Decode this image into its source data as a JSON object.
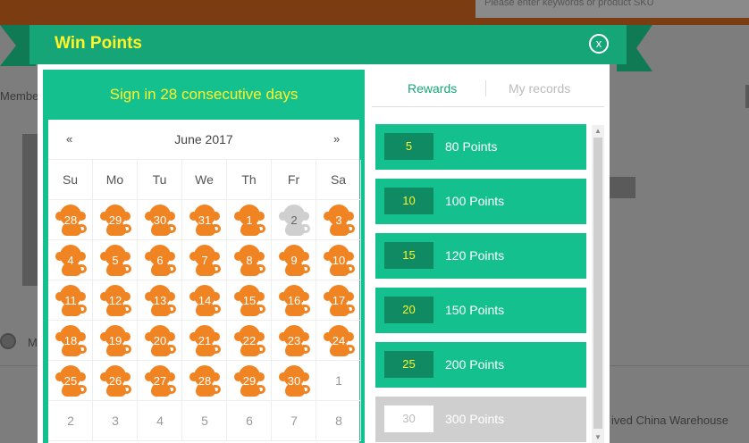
{
  "background": {
    "search_placeholder": "Please enter keywords or product SKU",
    "member_text": "Membe",
    "m_text": "M",
    "warehouse_text": "ived China Warehouse"
  },
  "modal": {
    "title": "Win Points",
    "close_icon": "x",
    "colors": {
      "accent": "#14c08e",
      "header": "#16a577",
      "title": "#fff42a",
      "signed": "#f08423",
      "missed": "#cfcfcf"
    }
  },
  "calendar": {
    "heading": "Sign in 28 consecutive days",
    "month": "June 2017",
    "prev": "«",
    "next": "»",
    "weekdays": [
      "Su",
      "Mo",
      "Tu",
      "We",
      "Th",
      "Fr",
      "Sa"
    ],
    "days": [
      {
        "n": "28",
        "s": "signed"
      },
      {
        "n": "29",
        "s": "signed"
      },
      {
        "n": "30",
        "s": "signed"
      },
      {
        "n": "31",
        "s": "signed"
      },
      {
        "n": "1",
        "s": "signed"
      },
      {
        "n": "2",
        "s": "missed"
      },
      {
        "n": "3",
        "s": "signed"
      },
      {
        "n": "4",
        "s": "signed"
      },
      {
        "n": "5",
        "s": "signed"
      },
      {
        "n": "6",
        "s": "signed"
      },
      {
        "n": "7",
        "s": "signed"
      },
      {
        "n": "8",
        "s": "signed"
      },
      {
        "n": "9",
        "s": "signed"
      },
      {
        "n": "10",
        "s": "signed"
      },
      {
        "n": "11",
        "s": "signed"
      },
      {
        "n": "12",
        "s": "signed"
      },
      {
        "n": "13",
        "s": "signed"
      },
      {
        "n": "14",
        "s": "signed"
      },
      {
        "n": "15",
        "s": "signed"
      },
      {
        "n": "16",
        "s": "signed"
      },
      {
        "n": "17",
        "s": "signed"
      },
      {
        "n": "18",
        "s": "signed"
      },
      {
        "n": "19",
        "s": "signed"
      },
      {
        "n": "20",
        "s": "signed"
      },
      {
        "n": "21",
        "s": "signed"
      },
      {
        "n": "22",
        "s": "signed"
      },
      {
        "n": "23",
        "s": "signed"
      },
      {
        "n": "24",
        "s": "signed"
      },
      {
        "n": "25",
        "s": "signed"
      },
      {
        "n": "26",
        "s": "signed"
      },
      {
        "n": "27",
        "s": "signed"
      },
      {
        "n": "28",
        "s": "signed"
      },
      {
        "n": "29",
        "s": "signed"
      },
      {
        "n": "30",
        "s": "signed"
      },
      {
        "n": "1",
        "s": "plain"
      },
      {
        "n": "2",
        "s": "plain"
      },
      {
        "n": "3",
        "s": "plain"
      },
      {
        "n": "4",
        "s": "plain"
      },
      {
        "n": "5",
        "s": "plain"
      },
      {
        "n": "6",
        "s": "plain"
      },
      {
        "n": "7",
        "s": "plain"
      },
      {
        "n": "8",
        "s": "plain"
      }
    ]
  },
  "tabs": {
    "rewards": "Rewards",
    "records": "My records"
  },
  "rewards": [
    {
      "days": "5",
      "label": "80 Points",
      "locked": false
    },
    {
      "days": "10",
      "label": "100 Points",
      "locked": false
    },
    {
      "days": "15",
      "label": "120 Points",
      "locked": false
    },
    {
      "days": "20",
      "label": "150 Points",
      "locked": false
    },
    {
      "days": "25",
      "label": "200 Points",
      "locked": false
    },
    {
      "days": "30",
      "label": "300 Points",
      "locked": true
    }
  ],
  "scroll": {
    "up": "▲",
    "down": "▼"
  }
}
